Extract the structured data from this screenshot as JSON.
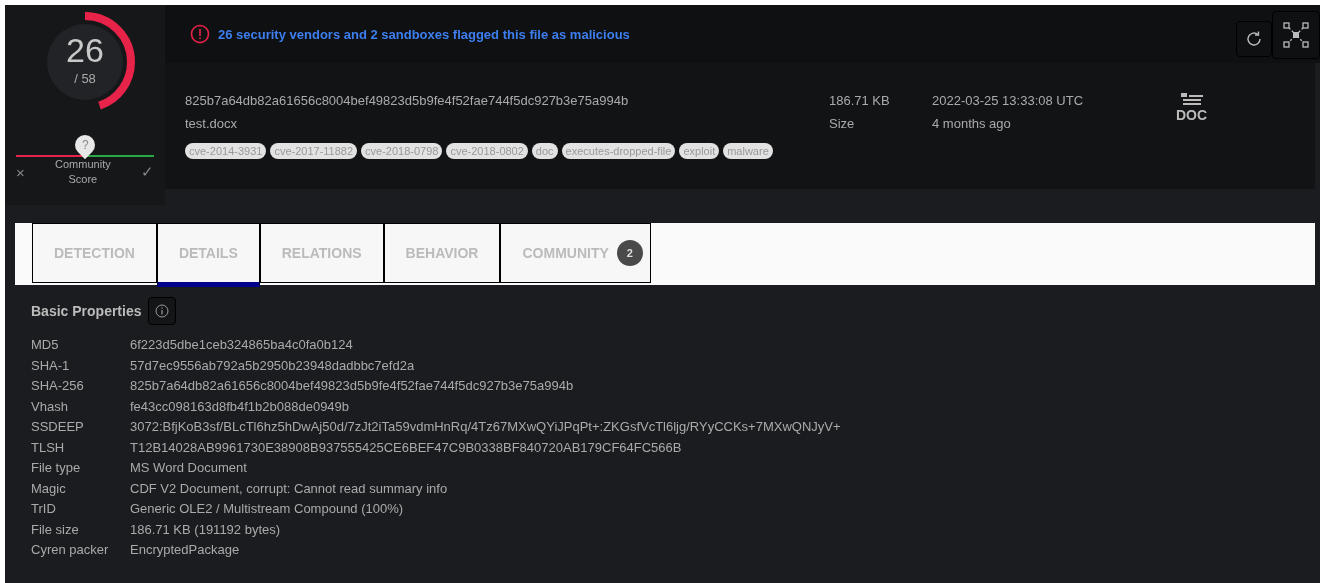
{
  "score": {
    "detections": "26",
    "total": "/ 58"
  },
  "community": {
    "mark": "?",
    "label": "Community Score",
    "negative": "×",
    "positive": "✓"
  },
  "alert": "26 security vendors and 2 sandboxes flagged this file as malicious",
  "file": {
    "hash": "825b7a64db82a61656c8004bef49823d5b9fe4f52fae744f5dc927b3e75a994b",
    "name": "test.docx",
    "size": "186.71 KB",
    "size_label": "Size",
    "date": "2022-03-25 13:33:08 UTC",
    "age": "4 months ago",
    "type_icon": "DOC",
    "tags": [
      "cve-2014-3931",
      "cve-2017-11882",
      "cve-2018-0798",
      "cve-2018-0802",
      "doc",
      "executes-dropped-file",
      "exploit",
      "malware"
    ]
  },
  "tabs": [
    {
      "label": "DETECTION",
      "selected": false
    },
    {
      "label": "DETAILS",
      "selected": true
    },
    {
      "label": "RELATIONS",
      "selected": false
    },
    {
      "label": "BEHAVIOR",
      "selected": false
    },
    {
      "label": "COMMUNITY",
      "selected": false,
      "count": "2"
    }
  ],
  "section": {
    "title": "Basic Properties",
    "properties": [
      {
        "key": "MD5",
        "value": "6f223d5dbe1ceb324865ba4c0fa0b124"
      },
      {
        "key": "SHA-1",
        "value": "57d7ec9556ab792a5b2950b23948dadbbc7efd2a"
      },
      {
        "key": "SHA-256",
        "value": "825b7a64db82a61656c8004bef49823d5b9fe4f52fae744f5dc927b3e75a994b"
      },
      {
        "key": "Vhash",
        "value": "fe43cc098163d8fb4f1b2b088de0949b"
      },
      {
        "key": "SSDEEP",
        "value": "3072:BfjKoB3sf/BLcTl6hz5hDwAj50d/7zJt2iTa59vdmHnRq/4Tz67MXwQYiJPqPt+:ZKGsfVcTl6ljg/RYyCCKs+7MXwQNJyV+"
      },
      {
        "key": "TLSH",
        "value": "T12B14028AB9961730E38908B937555425CE6BEF47C9B0338BF840720AB179CF64FC566B"
      },
      {
        "key": "File type",
        "value": "MS Word Document"
      },
      {
        "key": "Magic",
        "value": "CDF V2 Document, corrupt: Cannot read summary info"
      },
      {
        "key": "TrID",
        "value": "Generic OLE2 / Multistream Compound (100%)"
      },
      {
        "key": "File size",
        "value": "186.71 KB (191192 bytes)"
      },
      {
        "key": "Cyren packer",
        "value": "EncryptedPackage"
      }
    ]
  }
}
